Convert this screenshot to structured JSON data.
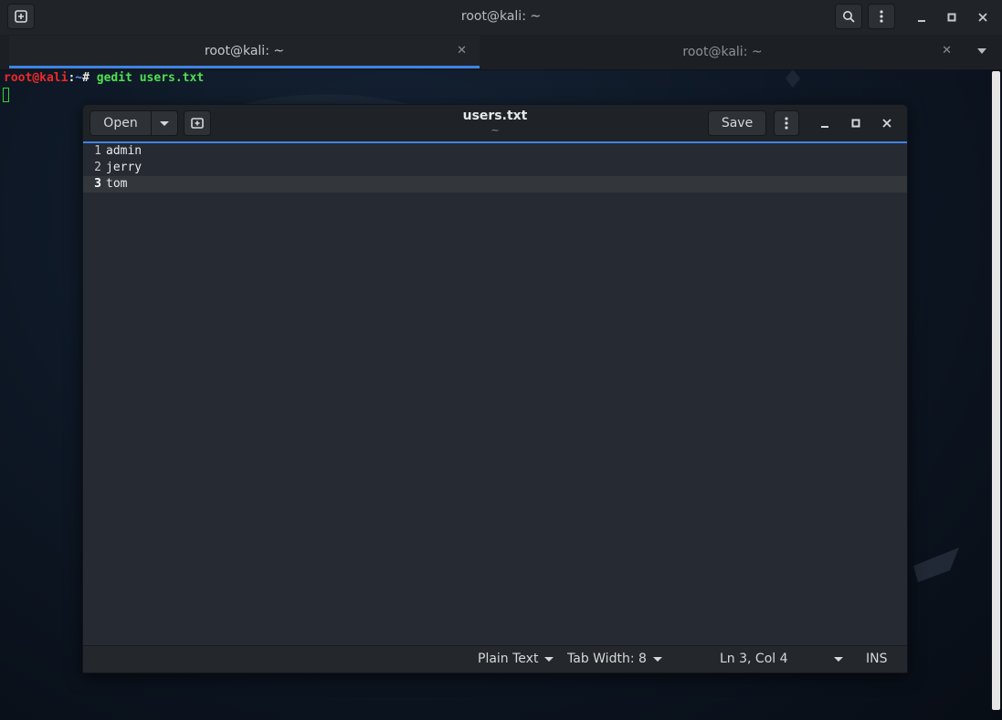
{
  "terminal": {
    "title": "root@kali: ~",
    "tabs": [
      {
        "label": "root@kali: ~",
        "active": true
      },
      {
        "label": "root@kali: ~",
        "active": false
      }
    ],
    "prompt": {
      "user_host": "root@kali",
      "sep": ":",
      "path": "~",
      "symbol": "#",
      "command": " gedit users.txt"
    }
  },
  "gedit": {
    "open_label": "Open",
    "save_label": "Save",
    "title": "users.txt",
    "subtitle": "~",
    "lines": [
      {
        "num": "1",
        "text": "admin"
      },
      {
        "num": "2",
        "text": "jerry"
      },
      {
        "num": "3",
        "text": "tom"
      }
    ],
    "current_line": 3,
    "status": {
      "language": "Plain Text",
      "tab_width": "Tab Width: 8",
      "position": "Ln 3, Col 4",
      "mode": "INS"
    }
  },
  "colors": {
    "accent": "#3d84e6",
    "prompt_red": "#ef2929",
    "prompt_green": "#4fe04f"
  },
  "icons": [
    "new-tab-icon",
    "search-icon",
    "menu-icon",
    "minimize-icon",
    "maximize-icon",
    "close-icon",
    "tab-close-icon",
    "tabs-dropdown-icon",
    "open-dropdown-icon",
    "new-document-icon",
    "gedit-menu-icon"
  ]
}
